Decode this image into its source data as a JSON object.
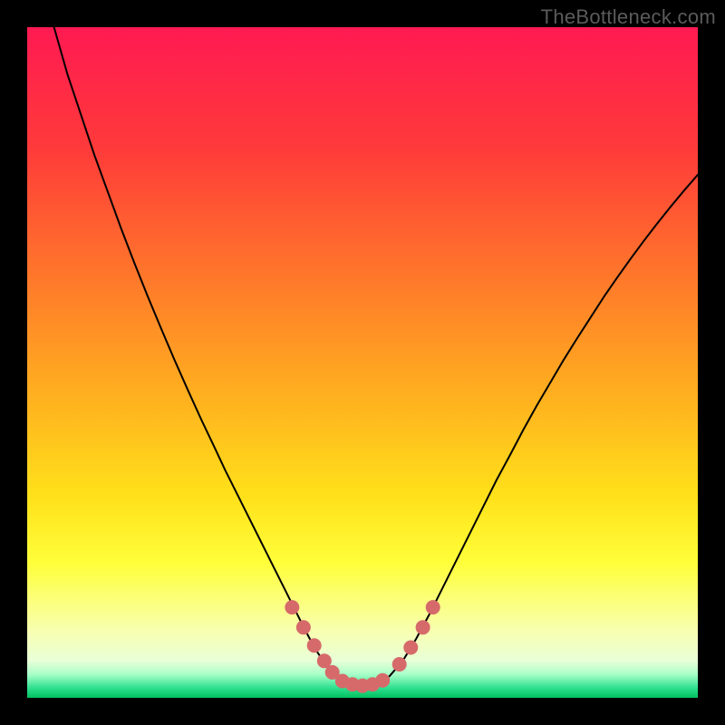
{
  "watermark": "TheBottleneck.com",
  "chart_data": {
    "type": "line",
    "title": "",
    "xlabel": "",
    "ylabel": "",
    "xlim": [
      0,
      1
    ],
    "ylim": [
      0,
      1
    ],
    "background_gradient_stops": [
      {
        "offset": 0.0,
        "color": "#ff1a52"
      },
      {
        "offset": 0.18,
        "color": "#ff3a3a"
      },
      {
        "offset": 0.38,
        "color": "#ff7a2a"
      },
      {
        "offset": 0.55,
        "color": "#ffb01f"
      },
      {
        "offset": 0.7,
        "color": "#ffe11a"
      },
      {
        "offset": 0.8,
        "color": "#ffff3a"
      },
      {
        "offset": 0.9,
        "color": "#f8ffb0"
      },
      {
        "offset": 0.945,
        "color": "#e8ffd8"
      },
      {
        "offset": 0.965,
        "color": "#a8ffc8"
      },
      {
        "offset": 0.985,
        "color": "#30e090"
      },
      {
        "offset": 1.0,
        "color": "#00c060"
      }
    ],
    "series": [
      {
        "name": "curve",
        "stroke": "#000000",
        "stroke_width": 2,
        "x": [
          0.04,
          0.06,
          0.08,
          0.1,
          0.12,
          0.14,
          0.16,
          0.18,
          0.2,
          0.22,
          0.24,
          0.26,
          0.28,
          0.295,
          0.31,
          0.325,
          0.34,
          0.355,
          0.37,
          0.385,
          0.4,
          0.415,
          0.43,
          0.445,
          0.46,
          0.48,
          0.5,
          0.52,
          0.54,
          0.56,
          0.58,
          0.6,
          0.62,
          0.64,
          0.66,
          0.68,
          0.7,
          0.72,
          0.74,
          0.76,
          0.78,
          0.8,
          0.82,
          0.84,
          0.86,
          0.88,
          0.9,
          0.92,
          0.94,
          0.96,
          0.98,
          1.0
        ],
        "y": [
          1.0,
          0.93,
          0.87,
          0.81,
          0.755,
          0.7,
          0.648,
          0.598,
          0.55,
          0.503,
          0.458,
          0.414,
          0.372,
          0.34,
          0.31,
          0.28,
          0.25,
          0.22,
          0.19,
          0.16,
          0.13,
          0.1,
          0.072,
          0.05,
          0.035,
          0.022,
          0.017,
          0.02,
          0.032,
          0.055,
          0.088,
          0.125,
          0.165,
          0.205,
          0.245,
          0.285,
          0.325,
          0.362,
          0.4,
          0.436,
          0.47,
          0.504,
          0.536,
          0.567,
          0.598,
          0.627,
          0.655,
          0.682,
          0.708,
          0.733,
          0.757,
          0.78
        ]
      },
      {
        "name": "left-dots",
        "stroke": "#d66a6a",
        "marker_radius": 8,
        "x": [
          0.395,
          0.412,
          0.428,
          0.443,
          0.455,
          0.47,
          0.485,
          0.5,
          0.515,
          0.53
        ],
        "y": [
          0.135,
          0.105,
          0.078,
          0.055,
          0.038,
          0.025,
          0.02,
          0.018,
          0.02,
          0.026
        ]
      },
      {
        "name": "right-dots",
        "stroke": "#d66a6a",
        "marker_radius": 8,
        "x": [
          0.555,
          0.572,
          0.59,
          0.605
        ],
        "y": [
          0.05,
          0.075,
          0.105,
          0.135
        ]
      }
    ]
  }
}
